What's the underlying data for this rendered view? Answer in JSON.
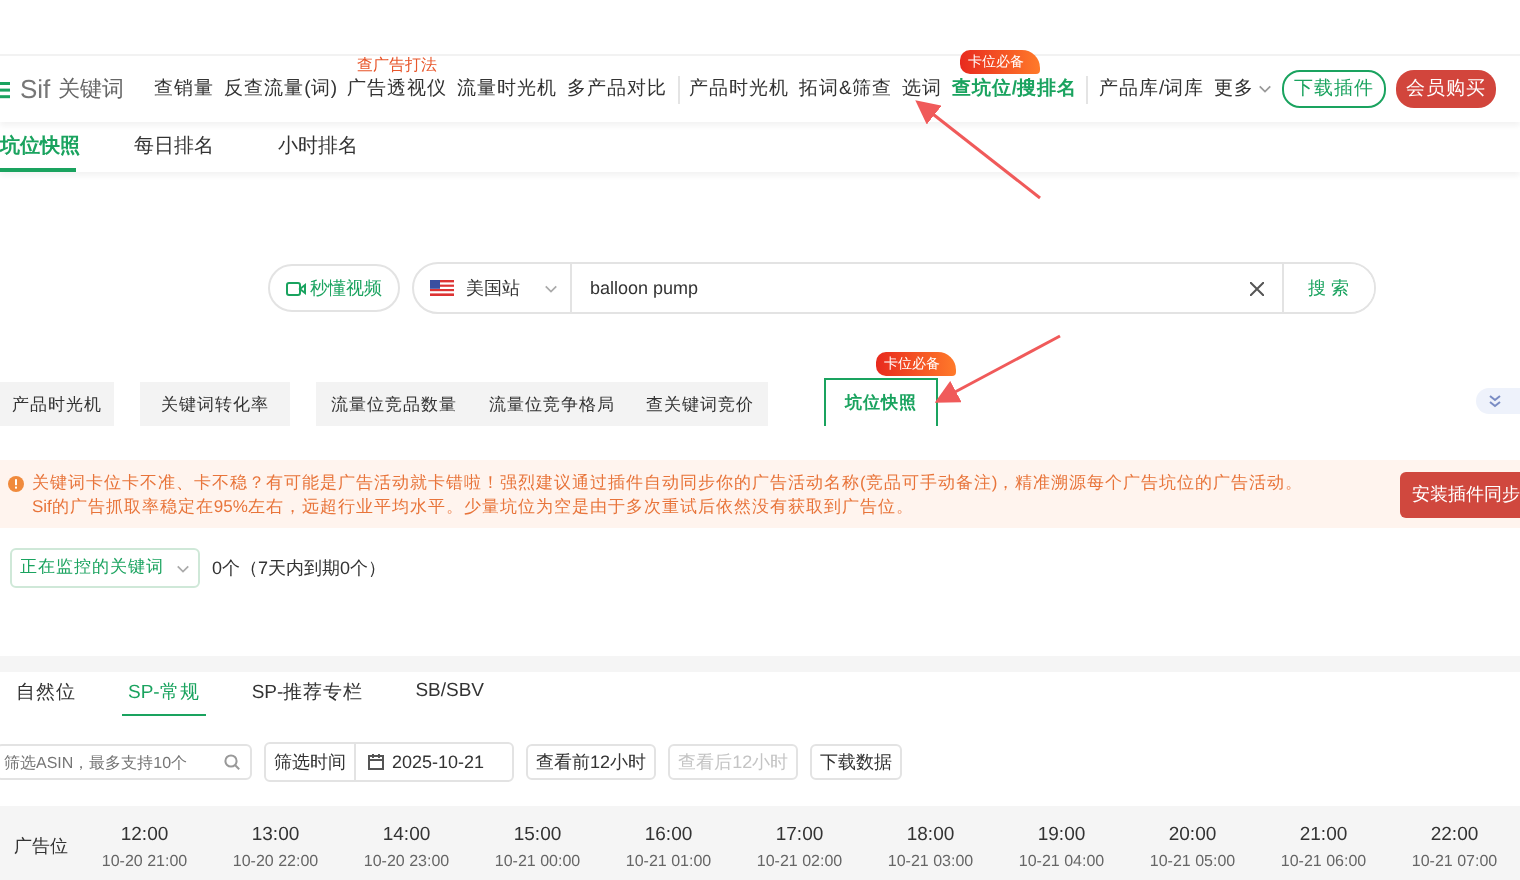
{
  "logo": {
    "text": "Sif",
    "subtitle": "关键词"
  },
  "nav": [
    {
      "label": "查销量",
      "kind": "link"
    },
    {
      "label": "反查流量(词)",
      "kind": "link"
    },
    {
      "label": "广告透视仪",
      "kind": "link",
      "tag": "查广告打法"
    },
    {
      "label": "流量时光机",
      "kind": "link"
    },
    {
      "label": "多产品对比",
      "kind": "link"
    },
    {
      "kind": "divider"
    },
    {
      "label": "产品时光机",
      "kind": "link"
    },
    {
      "label": "拓词&筛查",
      "kind": "link"
    },
    {
      "label": "选词",
      "kind": "link"
    },
    {
      "label": "查坑位/搜排名",
      "kind": "link",
      "selected": true,
      "flame": "卡位必备"
    },
    {
      "kind": "divider"
    },
    {
      "label": "产品库/词库",
      "kind": "link"
    },
    {
      "label": "更多",
      "kind": "menu"
    },
    {
      "label": "下载插件",
      "kind": "outline"
    },
    {
      "label": "会员购买",
      "kind": "solid"
    }
  ],
  "subtabs": [
    {
      "label": "坑位快照",
      "selected": true
    },
    {
      "label": "每日排名",
      "selected": false
    },
    {
      "label": "小时排名",
      "selected": false
    }
  ],
  "search": {
    "video_button": "秒懂视频",
    "site": "美国站",
    "value": "balloon pump",
    "button": "搜 索"
  },
  "tools": [
    {
      "label": "产品时光机",
      "selected": false
    },
    {
      "label": "关键词转化率",
      "selected": false
    },
    {
      "label": "流量位竞品数量",
      "selected": false
    },
    {
      "label": "流量位竞争格局",
      "selected": false
    },
    {
      "label": "查关键词竞价",
      "selected": false
    },
    {
      "label": "坑位快照",
      "selected": true,
      "flame": "卡位必备"
    }
  ],
  "notice": {
    "lines": [
      "关键词卡位卡不准、卡不稳？有可能是广告活动就卡错啦！强烈建议通过插件自动同步你的广告活动名称(竞品可手动备注)，精准溯源每个广告坑位的广告活动。",
      "Sif的广告抓取率稳定在95%左右，远超行业平均水平。少量坑位为空是由于多次重试后依然没有获取到广告位。"
    ],
    "button": "安装插件同步"
  },
  "monitor": {
    "select": "正在监控的关键词",
    "count": "0个（7天内到期0个）"
  },
  "placement_tabs": [
    {
      "label": "自然位",
      "selected": false
    },
    {
      "label": "SP-常规",
      "selected": true
    },
    {
      "label": "SP-推荐专栏",
      "selected": false
    },
    {
      "label": "SB/SBV",
      "selected": false
    }
  ],
  "filters": {
    "asin_placeholder": "筛选ASIN，最多支持10个",
    "time_label": "筛选时间",
    "date": "2025-10-21",
    "buttons": [
      {
        "label": "查看前12小时",
        "disabled": false
      },
      {
        "label": "查看后12小时",
        "disabled": true
      },
      {
        "label": "下载数据",
        "disabled": false
      }
    ]
  },
  "table": {
    "first_column": "广告位",
    "columns": [
      {
        "hour": "12:00",
        "local": "10-20 21:00"
      },
      {
        "hour": "13:00",
        "local": "10-20 22:00"
      },
      {
        "hour": "14:00",
        "local": "10-20 23:00"
      },
      {
        "hour": "15:00",
        "local": "10-21 00:00"
      },
      {
        "hour": "16:00",
        "local": "10-21 01:00"
      },
      {
        "hour": "17:00",
        "local": "10-21 02:00"
      },
      {
        "hour": "18:00",
        "local": "10-21 03:00"
      },
      {
        "hour": "19:00",
        "local": "10-21 04:00"
      },
      {
        "hour": "20:00",
        "local": "10-21 05:00"
      },
      {
        "hour": "21:00",
        "local": "10-21 06:00"
      },
      {
        "hour": "22:00",
        "local": "10-21 07:00"
      }
    ]
  }
}
